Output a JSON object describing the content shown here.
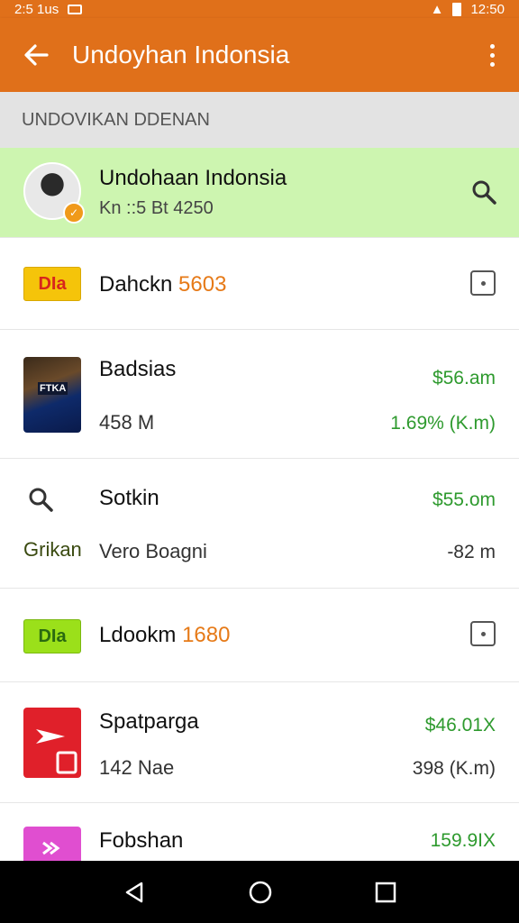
{
  "status_bar": {
    "left_text": "2:5 1us",
    "time": "12:50"
  },
  "app_bar": {
    "title": "Undoyhan Indonsia",
    "back_icon": "arrow-left-icon",
    "menu_icon": "more-vert-icon"
  },
  "section": {
    "header": "UNDOVIKAN DDENAN"
  },
  "profile": {
    "name": "Undohaan Indonsia",
    "subtitle": "Kn ::5 Bt 4250"
  },
  "rows": [
    {
      "title": "Dahckn",
      "accent": "5603",
      "tile_label": "DIa",
      "tile_color": "#f5c40a",
      "tile_text_color": "#d8261c"
    },
    {
      "title": "Badsias",
      "subtitle": "458 M",
      "value_top": "$56.am",
      "value_bottom": "1.69% (K.m)",
      "tile_label": "FTKA"
    },
    {
      "title": "Sotkin",
      "left_label": "Grikan",
      "subtitle": "Vero Boagni",
      "value_top": "$55.om",
      "value_bottom": "-82 m"
    },
    {
      "title": "Ldookm",
      "accent": "1680",
      "tile_label": "DIa",
      "tile_color": "#9be01a",
      "tile_text_color": "#2a6a10"
    },
    {
      "title": "Spatparga",
      "subtitle": "142 Nae",
      "value_top": "$46.01X",
      "value_bottom": "398 (K.m)",
      "tile_color": "#e0202a"
    },
    {
      "title": "Fobshan",
      "value_top": "159.9IX",
      "tile_color": "#e04ed0"
    }
  ],
  "colors": {
    "primary": "#e0701a",
    "highlight": "#cdf5b0",
    "green": "#2e9a2e",
    "accent": "#e67a18"
  }
}
